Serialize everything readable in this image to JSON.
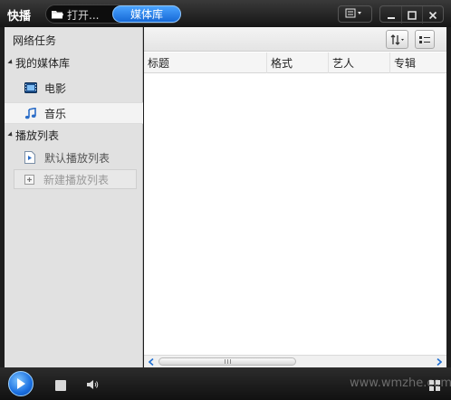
{
  "app": {
    "logo": "快播",
    "tabs": {
      "open_label": "打开...",
      "media_label": "媒体库"
    }
  },
  "window_controls": {
    "mode_icon": "list-layout-icon",
    "minimize_icon": "minimize-icon",
    "maximize_icon": "maximize-icon",
    "close_icon": "close-icon"
  },
  "sidebar": {
    "network_tasks": "网络任务",
    "library": {
      "label": "我的媒体库",
      "items": [
        {
          "label": "电影",
          "icon": "film-icon"
        },
        {
          "label": "音乐",
          "icon": "music-note-icon"
        }
      ]
    },
    "playlists": {
      "label": "播放列表",
      "items": [
        {
          "label": "默认播放列表",
          "icon": "playlist-icon"
        },
        {
          "label": "新建播放列表",
          "icon": "add-playlist-icon"
        }
      ]
    }
  },
  "table": {
    "columns": [
      "标题",
      "格式",
      "艺人",
      "专辑"
    ],
    "rows": []
  },
  "footer": {
    "watermark": "www.wmzhe.com"
  },
  "colors": {
    "accent": "#1f7be6",
    "sidebar_bg": "#e1e1e1",
    "titlebar_bg": "#1e1e1e"
  }
}
